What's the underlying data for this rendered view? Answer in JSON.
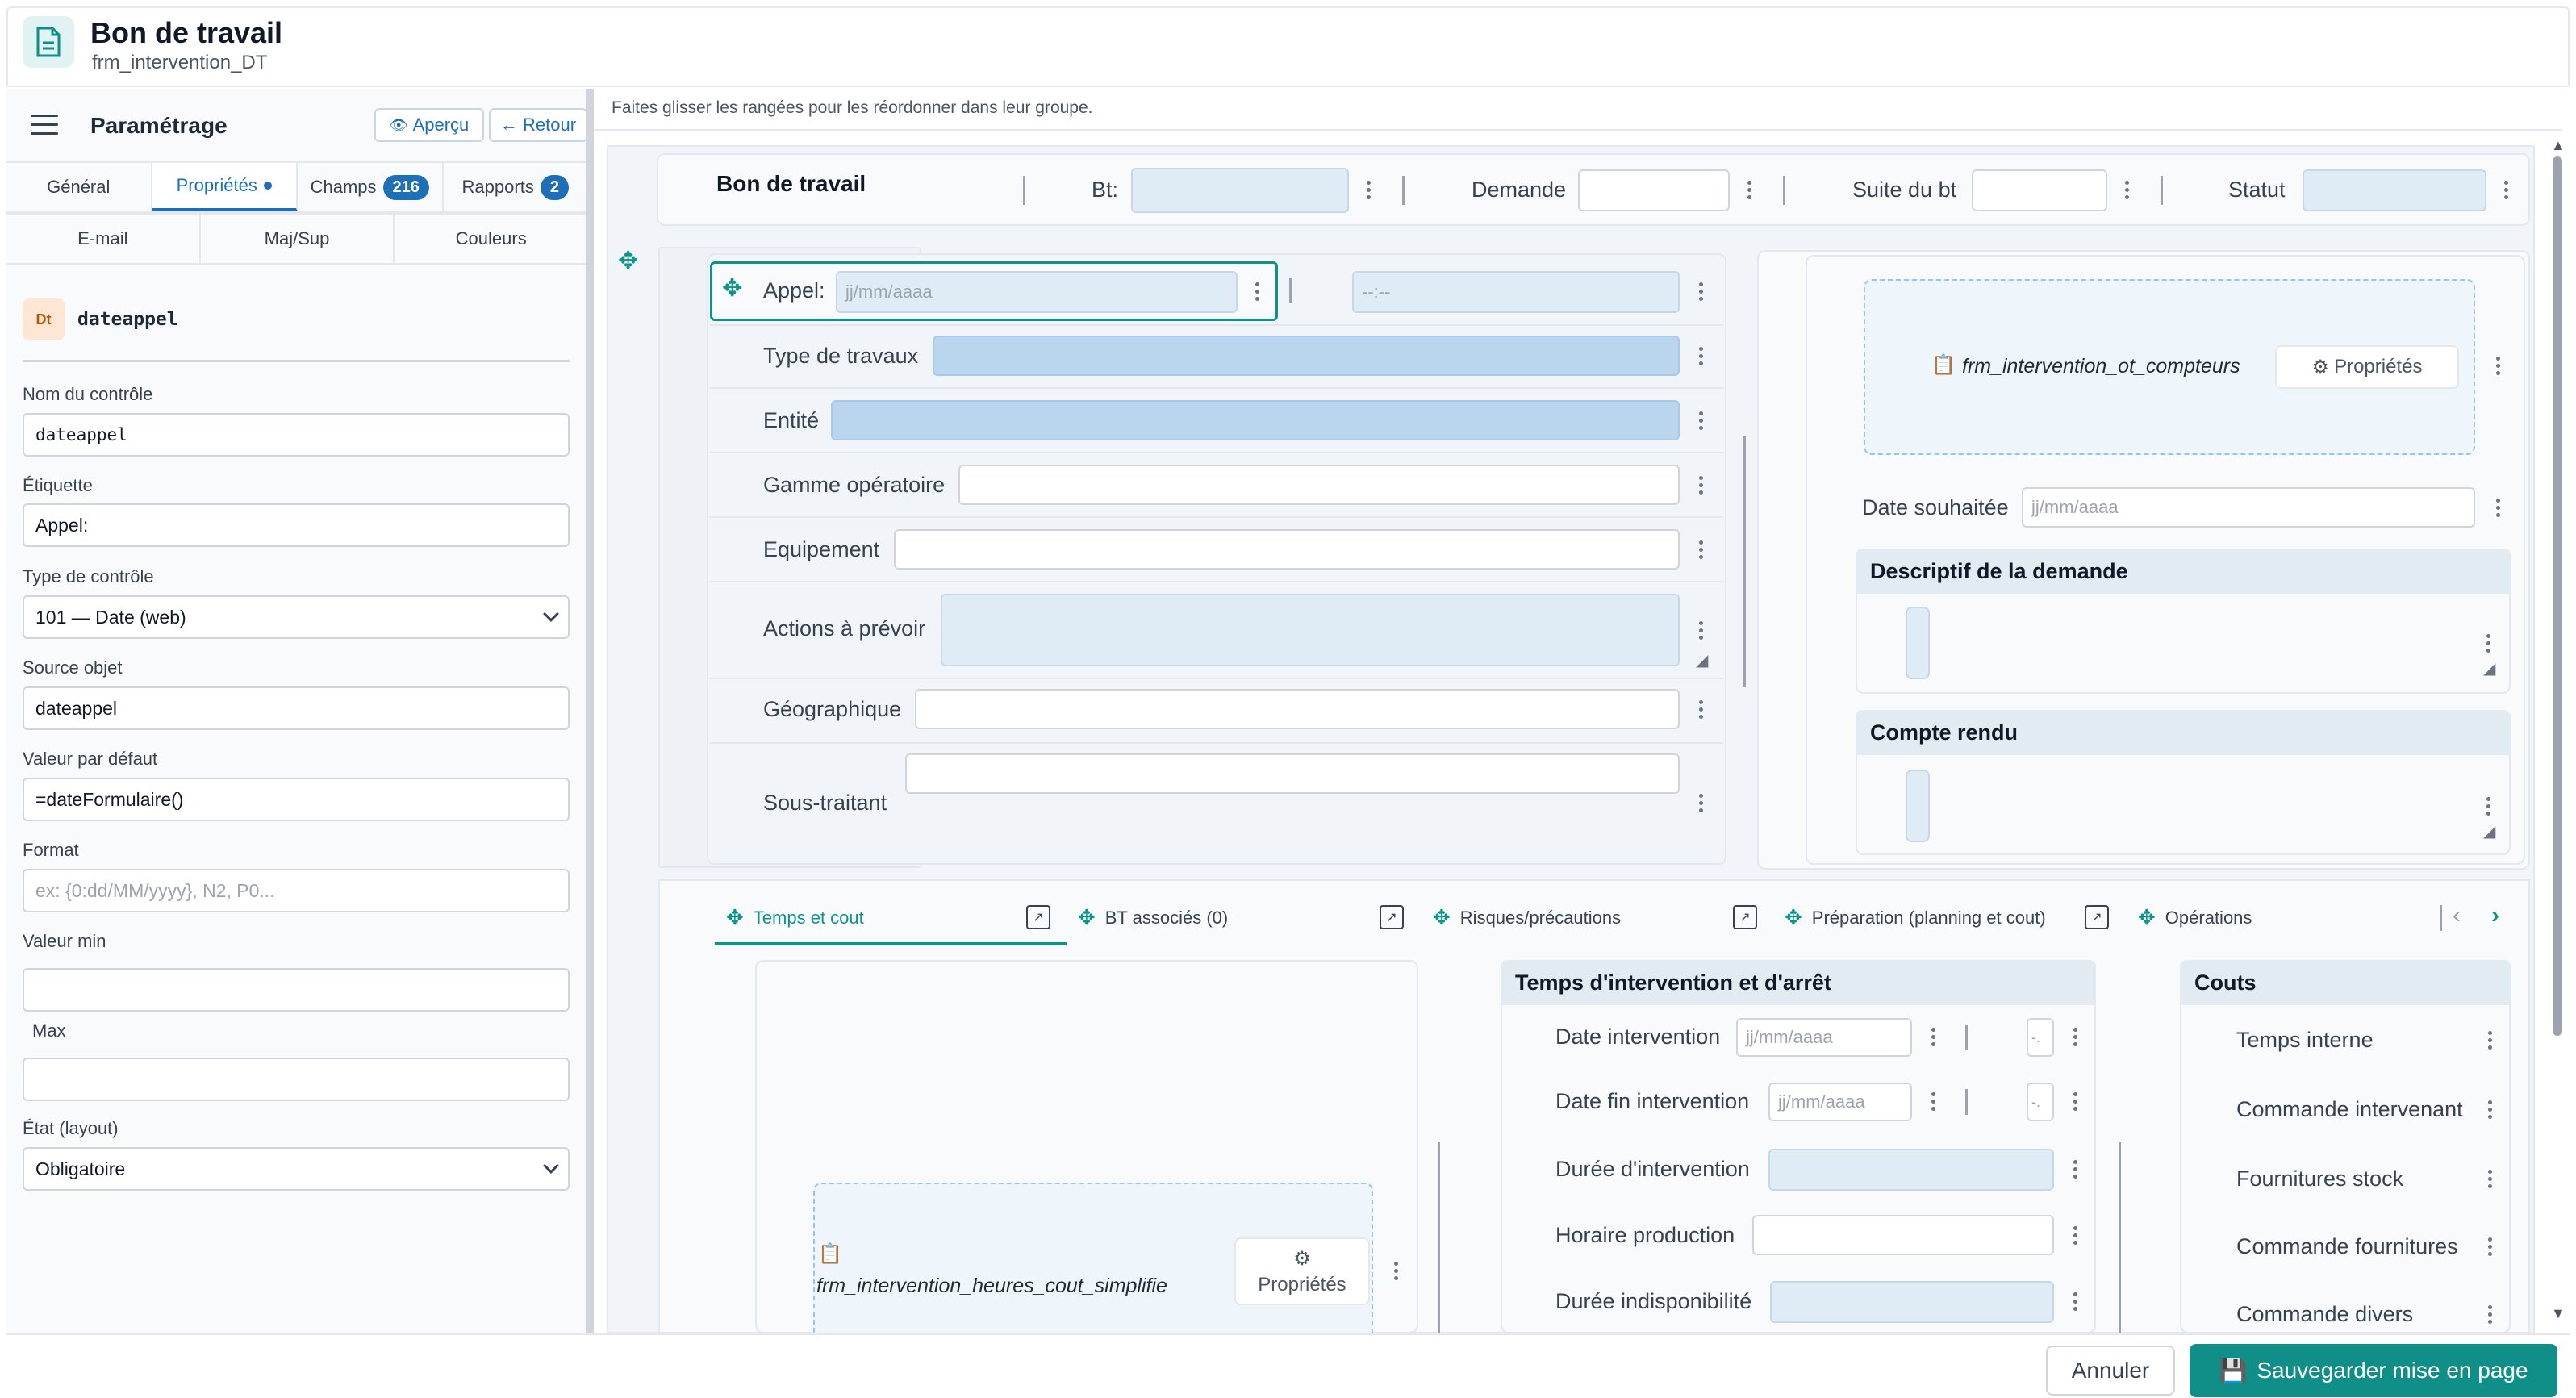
{
  "header": {
    "title": "Bon de travail",
    "subtitle": "frm_intervention_DT",
    "icon": "document-icon"
  },
  "left": {
    "title": "Paramétrage",
    "preview_label": "Aperçu",
    "back_label": "← Retour",
    "tabs1": [
      {
        "label": "Général"
      },
      {
        "label": "Propriétés"
      },
      {
        "label": "Champs",
        "badge": "216"
      },
      {
        "label": "Rapports",
        "badge": "2"
      }
    ],
    "tabs2": [
      {
        "label": "E-mail"
      },
      {
        "label": "Maj/Sup"
      },
      {
        "label": "Couleurs"
      }
    ],
    "control_badge": "Dt",
    "control_name": "dateappel",
    "fields": {
      "nom_label": "Nom du contrôle",
      "nom_value": "dateappel",
      "etiquette_label": "Étiquette",
      "etiquette_value": "Appel:",
      "type_label": "Type de contrôle",
      "type_value": "101 — Date (web)",
      "source_label": "Source objet",
      "source_value": "dateappel",
      "defaut_label": "Valeur par défaut",
      "defaut_value": "=dateFormulaire()",
      "format_label": "Format",
      "format_placeholder": "ex: {0:dd/MM/yyyy}, N2, P0...",
      "min_label": "Valeur min",
      "max_label": "Max",
      "etat_label": "État (layout)",
      "etat_value": "Obligatoire"
    }
  },
  "main": {
    "hint": "Faites glisser les rangées pour les réordonner dans leur groupe.",
    "top": {
      "title": "Bon de travail",
      "bt": "Bt:",
      "demande": "Demande",
      "suite": "Suite du bt",
      "statut": "Statut"
    },
    "left_fields": {
      "appel": "Appel:",
      "appel_ph": "jj/mm/aaaa",
      "time_ph": "--:--",
      "type_travaux": "Type de travaux",
      "entite": "Entité",
      "gamme": "Gamme opératoire",
      "equipement": "Equipement",
      "actions": "Actions à prévoir",
      "geo": "Géographique",
      "sous_traitant": "Sous-traitant"
    },
    "right": {
      "subform": "frm_intervention_ot_compteurs",
      "props": "Propriétés",
      "date_souhaitee": "Date souhaitée",
      "date_ph": "jj/mm/aaaa",
      "descriptif": "Descriptif de la demande",
      "compte_rendu": "Compte rendu"
    },
    "subtabs": [
      {
        "label": "Temps et cout"
      },
      {
        "label": "BT associés (0)"
      },
      {
        "label": "Risques/précautions"
      },
      {
        "label": "Préparation (planning et cout)"
      },
      {
        "label": "Opérations"
      }
    ],
    "bottom": {
      "subform2": "frm_intervention_heures_cout_simplifie",
      "props2": "Propriétés",
      "temps_title": "Temps d'intervention et d'arrêt",
      "date_intervention": "Date intervention",
      "date_fin": "Date fin intervention",
      "duree": "Durée d'intervention",
      "horaire": "Horaire production",
      "indispo": "Durée indisponibilité",
      "date_ph": "jj/mm/aaaa",
      "dash": "-.",
      "couts_title": "Couts",
      "couts": [
        "Temps interne",
        "Commande intervenant",
        "Fournitures stock",
        "Commande fournitures",
        "Commande divers"
      ]
    }
  },
  "footer": {
    "cancel": "Annuler",
    "save": "Sauvegarder mise en page"
  },
  "colors": {
    "accent": "#0f8f87",
    "link": "#1d6fb8",
    "selected_border": "#0d9488"
  }
}
